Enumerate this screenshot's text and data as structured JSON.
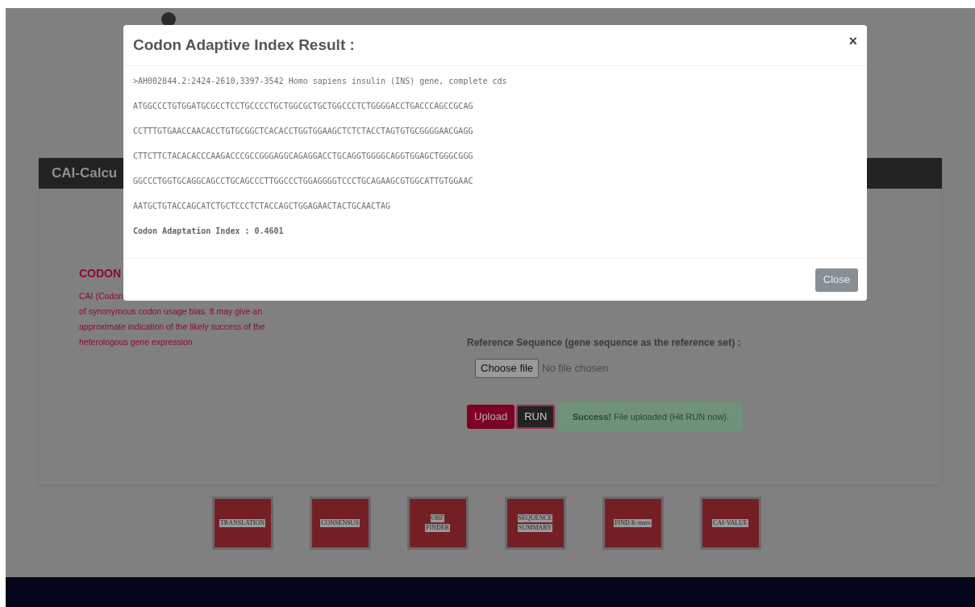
{
  "page": {
    "card_title": "CAI-Calcu",
    "info_heading": "CODON",
    "info_lines": [
      "CAI (Codon",
      "of synonymous codon usage bias. It may give an",
      "approximate indication of the likely success of the",
      "heterologous gene expression"
    ],
    "reference_label": "Reference Sequence (gene sequence as the reference set) :",
    "file_input": {
      "button": "Choose file",
      "status": "No file chosen"
    },
    "buttons": [
      {
        "label": "Upload",
        "kind": "primary"
      },
      {
        "label": "RUN",
        "kind": "dark"
      }
    ],
    "alert": "**Success!** File uploaded (Hit RUN now).",
    "tools": [
      {
        "lines": [
          "TRANSLATION"
        ]
      },
      {
        "lines": [
          "CONSENSUS"
        ]
      },
      {
        "lines": [
          "ORF",
          "FINDER"
        ]
      },
      {
        "lines": [
          "SEQUENCE",
          "SUMMARY"
        ]
      },
      {
        "lines": [
          "FIND K-mers"
        ]
      },
      {
        "lines": [
          "CAI-VALUE"
        ]
      }
    ]
  },
  "modal": {
    "title": "Codon Adaptive Index Result :",
    "close": "×",
    "header_line": ">AH002844.2:2424-2610,3397-3542 Homo sapiens insulin (INS) gene, complete cds",
    "sequence_lines": [
      "ATGGCCCTGTGGATGCGCCTCCTGCCCCTGCTGGCGCTGCTGGCCCTCTGGGGACCTGACCCAGCCGCAG",
      "CCTTTGTGAACCAACACCTGTGCGGCTCACACCTGGTGGAAGCTCTCTACCTAGTGTGCGGGGAACGAGG",
      "CTTCTTCTACACACCCAAGACCCGCCGGGAGGCAGAGGACCTGCAGGTGGGGCAGGTGGAGCTGGGCGGG",
      "GGCCCTGGTGCAGGCAGCCTGCAGCCCTTGGCCCTGGAGGGGTCCCTGCAGAAGCGTGGCATTGTGGAAC",
      "AATGCTGTACCAGCATCTGCTCCCTCTACCAGCTGGAGAACTACTGCAACTAG"
    ],
    "result": "Codon Adaptation Index : 0.4601",
    "buttons": [
      "Close"
    ]
  }
}
